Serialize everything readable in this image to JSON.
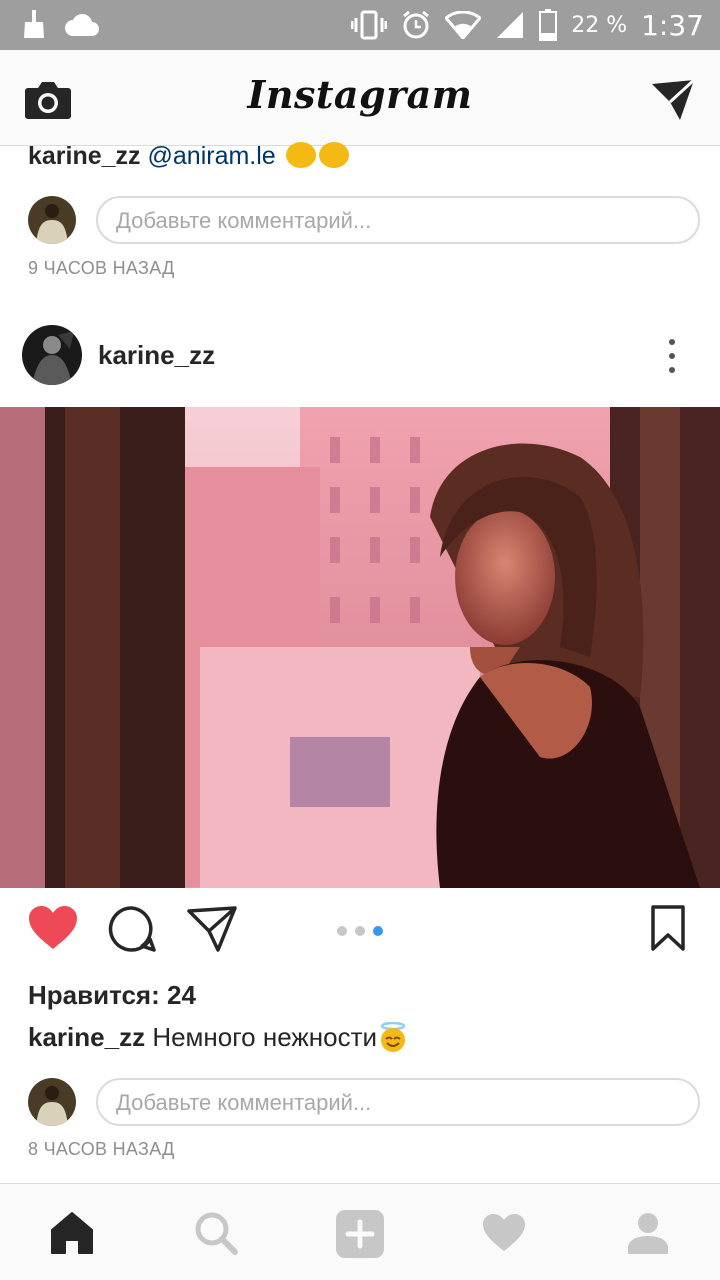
{
  "status_bar": {
    "battery_percent": "22 %",
    "time": "1:37",
    "icons": [
      "broom-icon",
      "cloud-icon",
      "vibrate-icon",
      "alarm-icon",
      "wifi-icon",
      "signal-icon",
      "battery-icon"
    ]
  },
  "header": {
    "logo": "Instagram",
    "left_icon": "camera-icon",
    "right_icon": "direct-message-icon"
  },
  "prev_post": {
    "caption_user": "karine_zz",
    "caption_mention": "@aniram.le",
    "comment_placeholder": "Добавьте комментарий...",
    "timestamp": "9 ЧАСОВ НАЗАД"
  },
  "post": {
    "username": "karine_zz",
    "liked": true,
    "carousel": {
      "count": 3,
      "active_index": 2
    },
    "likes_text": "Нравится: 24",
    "caption_user": "karine_zz",
    "caption_text": "Немного нежности",
    "comment_placeholder": "Добавьте комментарий...",
    "timestamp": "8 ЧАСОВ НАЗАД"
  },
  "colors": {
    "like_red": "#ed4956",
    "mention_blue": "#003569",
    "carousel_active": "#3897f0"
  },
  "bottom_nav": [
    {
      "icon": "home-icon",
      "active": true
    },
    {
      "icon": "search-icon",
      "active": false
    },
    {
      "icon": "add-post-icon",
      "active": false
    },
    {
      "icon": "activity-heart-icon",
      "active": false
    },
    {
      "icon": "profile-icon",
      "active": false
    }
  ]
}
